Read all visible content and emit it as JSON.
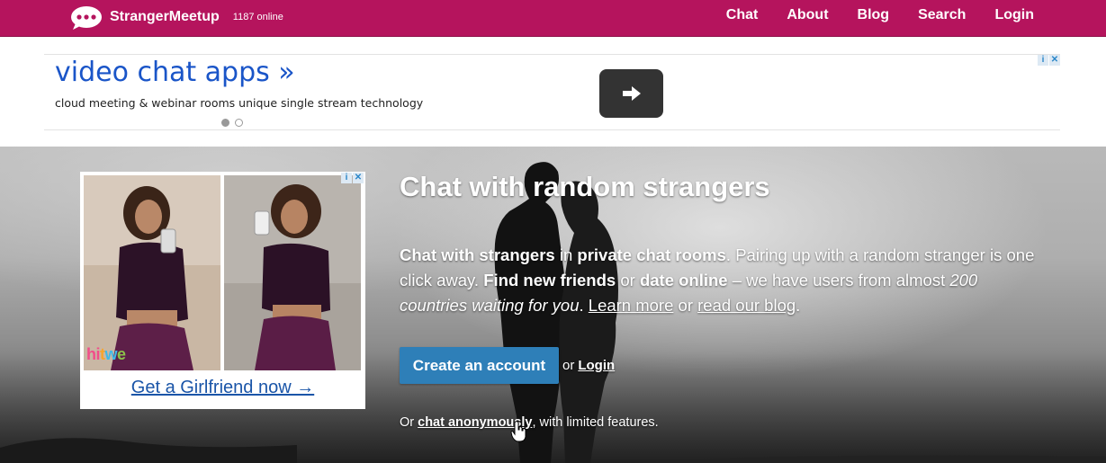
{
  "navbar": {
    "brand": "StrangerMeetup",
    "online": "1187 online",
    "links": [
      "Chat",
      "About",
      "Blog",
      "Search",
      "Login"
    ],
    "color": "#b5145d"
  },
  "top_ad": {
    "title": "video chat apps »",
    "description": "cloud meeting & webinar rooms unique single stream technology",
    "icon": "arrow-right-icon"
  },
  "side_ad": {
    "brand_letters": [
      "hi",
      "t",
      "w",
      "e"
    ],
    "cta": "Get a Girlfriend now →"
  },
  "hero": {
    "title": "Chat with random strangers",
    "desc": {
      "p1_bold": "Chat with strangers",
      "p2": " in ",
      "p3_bold": "private chat rooms",
      "p4": ". Pairing up with a random stranger is one click away. ",
      "p5_bold": "Find new friends",
      "p6": " or ",
      "p7_bold": "date online",
      "p8": " – we have users from almost ",
      "p9_italic": "200 countries waiting for you",
      "p10": ". ",
      "learn_more": "Learn more",
      "p11": " or ",
      "read_blog": "read our blog",
      "p12": "."
    },
    "create_button": "Create an account",
    "or": "or",
    "login": "Login",
    "anon_prefix": "Or ",
    "anon_link": "chat anonymously",
    "anon_suffix": ", with limited features.",
    "button_color": "#2e7fb8"
  }
}
